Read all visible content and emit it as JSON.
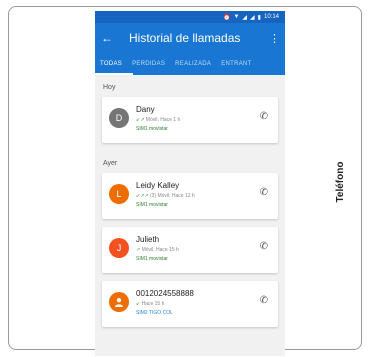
{
  "side_label": "Teléfono",
  "status_bar": {
    "time": "10:14"
  },
  "app_bar": {
    "title": "Historial de llamadas",
    "back_icon": "arrow-left-icon",
    "more_icon": "more-vert-icon"
  },
  "tabs": [
    {
      "label": "TODAS",
      "active": true
    },
    {
      "label": "PERDIDAS",
      "active": false
    },
    {
      "label": "REALIZADA",
      "active": false
    },
    {
      "label": "ENTRANT",
      "active": false
    }
  ],
  "sections": {
    "today": "Hoy",
    "yesterday": "Ayer"
  },
  "calls": [
    {
      "initial": "D",
      "name": "Dany",
      "arrows": "↙↗",
      "meta": "Móvil, Hace 1 h",
      "sim": "SIM1 movistar",
      "avatar_color": "#757575",
      "sim_color": "#2e7d32"
    },
    {
      "initial": "L",
      "name": "Leidy Kalley",
      "arrows": "↙↗↗",
      "meta": "(3) Móvil, Hace 12 h",
      "sim": "SIM1 movistar",
      "avatar_color": "#ef6c00",
      "sim_color": "#2e7d32"
    },
    {
      "initial": "J",
      "name": "Julieth",
      "arrows": "↗",
      "meta": "Móvil, Hace 15 h",
      "sim": "SIM1 movistar",
      "avatar_color": "#f4511e",
      "sim_color": "#2e7d32"
    },
    {
      "initial": "",
      "name": "0012024558888",
      "arrows": "↙",
      "meta": "Hace 15 h",
      "sim": "SIM2 TIGO COL",
      "avatar_color": "#ef6c00",
      "sim_color": "#1e88e5"
    }
  ],
  "colors": {
    "appbar": "#1976d2",
    "statusbar": "#1565c0"
  }
}
